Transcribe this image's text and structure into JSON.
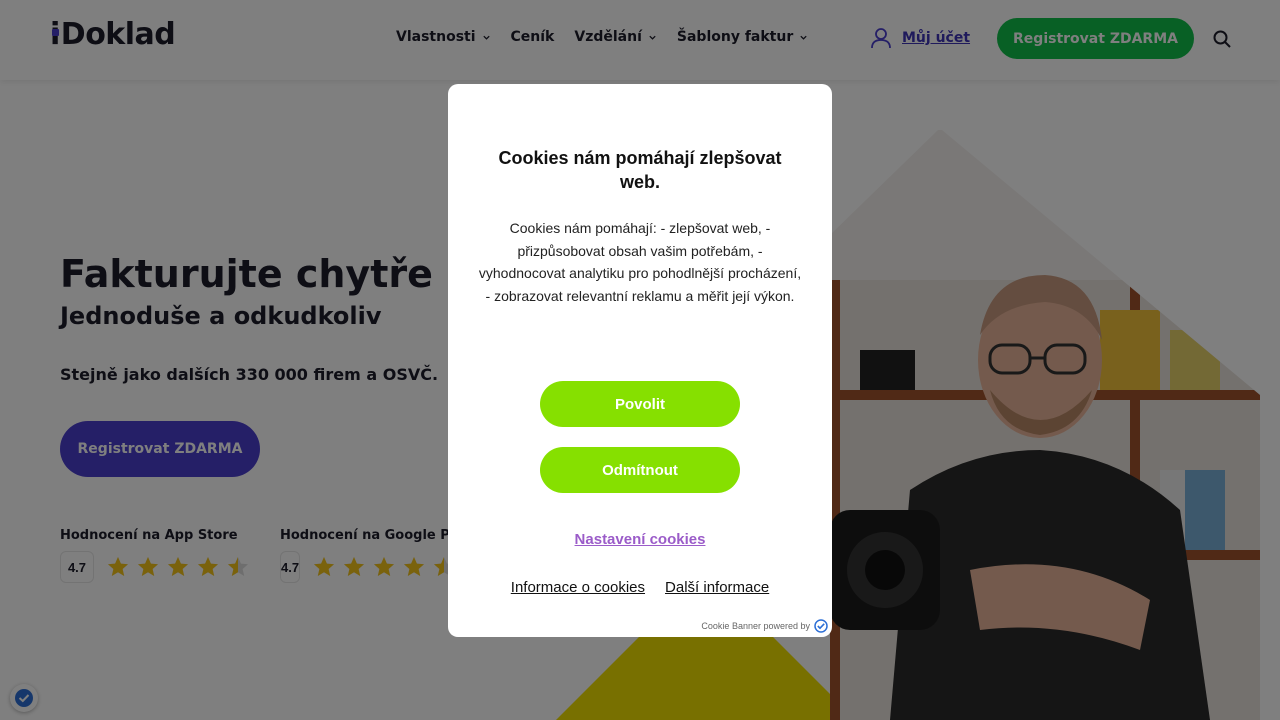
{
  "header": {
    "logo_text": "Doklad",
    "logo_alt_text": "iDoklad",
    "nav": [
      {
        "label": "Vlastnosti",
        "has_dropdown": true
      },
      {
        "label": "Ceník",
        "has_dropdown": false
      },
      {
        "label": "Vzdělání",
        "has_dropdown": true
      },
      {
        "label": "Šablony faktur",
        "has_dropdown": true
      }
    ],
    "account_label": "Můj účet",
    "register_label": "Registrovat ZDARMA",
    "search_icon": "search-icon"
  },
  "hero": {
    "title": "Fakturujte chytře",
    "subtitle": "Jednoduše a odkudkoliv",
    "note": "Stejně jako dalších 330 000 firem a OSVČ.",
    "register_label": "Registrovat ZDARMA",
    "ratings": [
      {
        "label": "Hodnocení na App Store",
        "score": "4.7",
        "stars": 4.5
      },
      {
        "label": "Hodnocení na Google Play",
        "score": "4.7",
        "stars": 4.5
      }
    ]
  },
  "cookie_modal": {
    "title": "Cookies nám pomáhají zlepšovat web.",
    "text": "Cookies nám pomáhají: - zlepšovat web, - přizpůsobovat obsah vašim potřebám, - vyhodnocovat analytiku pro pohodlnější procházení, - zobrazovat relevantní reklamu a měřit její výkon.",
    "allow_label": "Povolit",
    "deny_label": "Odmítnout",
    "settings_label": "Nastavení cookies",
    "info_label": "Informace o cookies",
    "more_label": "Další informace",
    "powered_label": "Cookie Banner powered by"
  },
  "colors": {
    "brand_purple": "#4b3ecf",
    "brand_green": "#11c04a",
    "cookie_button": "#86e000",
    "settings_link": "#9b5cc9",
    "star": "#f5c518",
    "overlay": "rgba(0,0,0,0.5)"
  }
}
